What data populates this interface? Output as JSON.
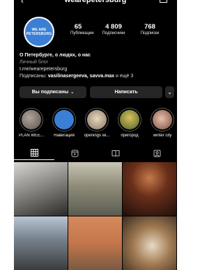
{
  "profile": {
    "username": "wearepetersburg",
    "avatar_text": "WE ARE PETERSBURG"
  },
  "stats": [
    {
      "value": "65",
      "label": "Публикации"
    },
    {
      "value": "4 809",
      "label": "Подписчики"
    },
    {
      "value": "768",
      "label": "Подписки"
    }
  ],
  "bio": {
    "name": "О Петербурге, о людях, о нас",
    "category": "Личный блог",
    "link": "t.me/wearepetersburg",
    "followed_prefix": "Подписаны: ",
    "followed_names": "vasilinasergeeva, savva.max",
    "followed_suffix": " и ещё 3"
  },
  "buttons": {
    "subscribed": "Вы подписаны",
    "message": "Написать"
  },
  "highlights": [
    {
      "label": "PLAN WEE...",
      "color": "#7a6b62"
    },
    {
      "label": "Навигация",
      "color": "#3a7fd5"
    },
    {
      "label": "openings wi...",
      "color": "#b09a7e"
    },
    {
      "label": "пригород",
      "color": "#8e7b3a"
    },
    {
      "label": "winter city",
      "color": "#a07060"
    }
  ],
  "tabs": [
    "grid-icon",
    "reels-icon",
    "guide-icon",
    "tagged-icon"
  ],
  "colors": {
    "background": "#000000",
    "button": "#262626",
    "avatar": "#3a7fd5"
  }
}
